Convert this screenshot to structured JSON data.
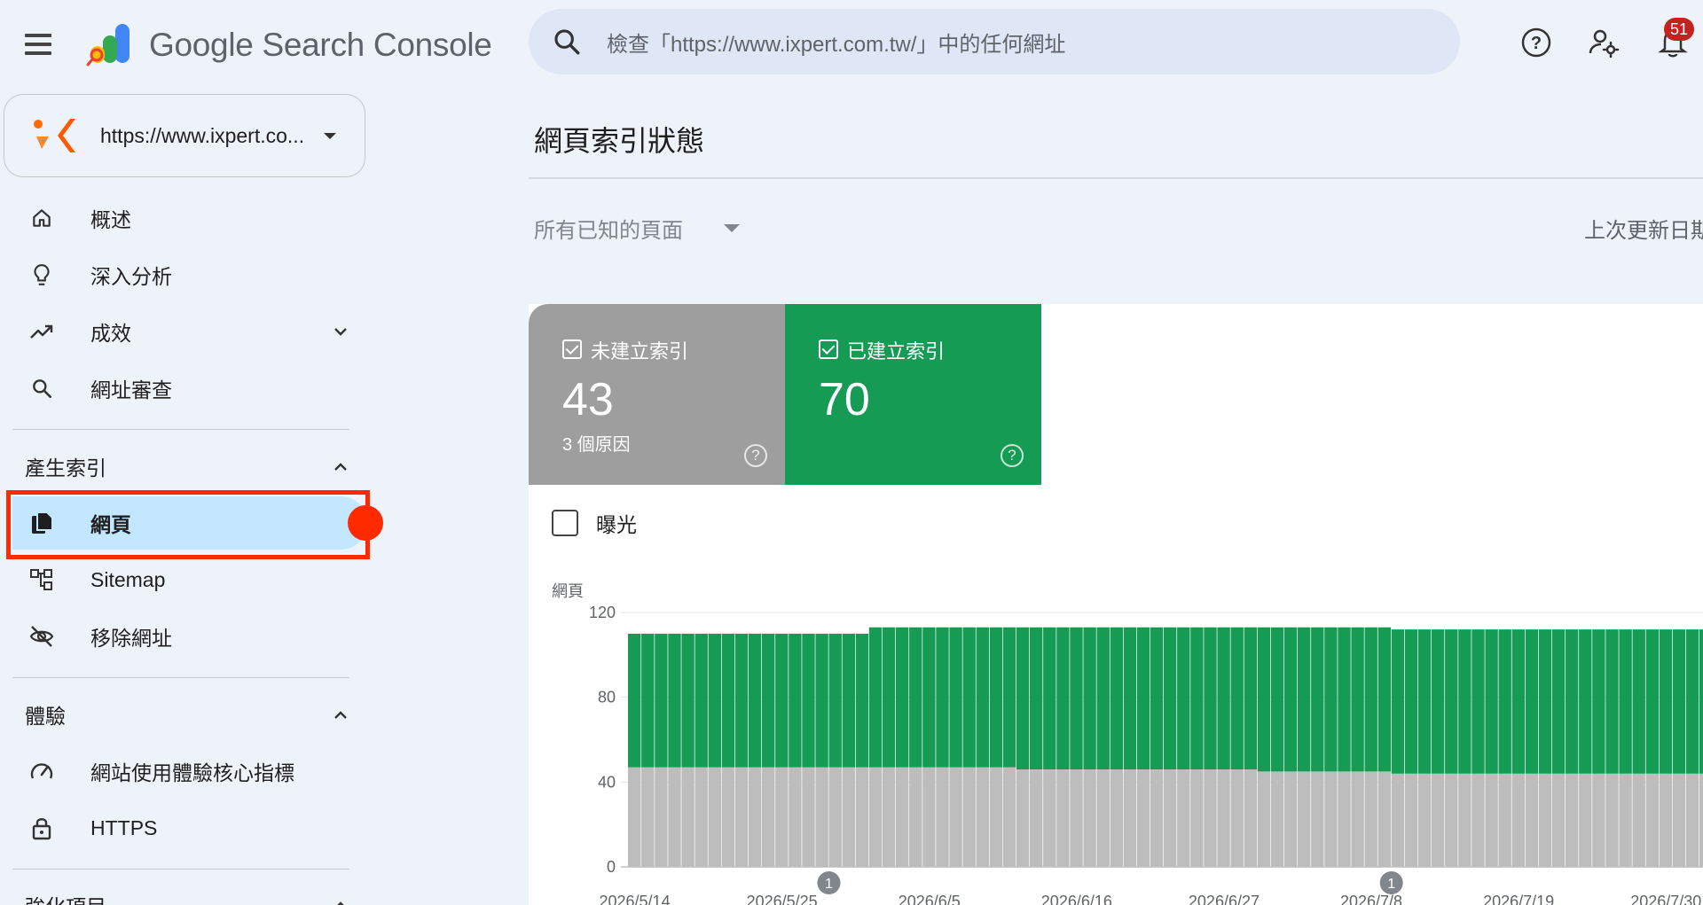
{
  "app": {
    "title": "Google Search Console"
  },
  "search": {
    "placeholder": "檢查「https://www.ixpert.com.tw/」中的任何網址"
  },
  "notifications": {
    "count": "51"
  },
  "property": {
    "url": "https://www.ixpert.co..."
  },
  "sidebar": {
    "items": [
      {
        "label": "概述",
        "icon": "home-icon"
      },
      {
        "label": "深入分析",
        "icon": "lightbulb-icon"
      },
      {
        "label": "成效",
        "icon": "trending-up-icon"
      },
      {
        "label": "網址審查",
        "icon": "search-icon"
      }
    ],
    "sections": [
      {
        "label": "產生索引",
        "items": [
          {
            "label": "網頁",
            "icon": "pages-icon",
            "active": true
          },
          {
            "label": "Sitemap",
            "icon": "sitemap-icon"
          },
          {
            "label": "移除網址",
            "icon": "visibility-off-icon"
          }
        ]
      },
      {
        "label": "體驗",
        "items": [
          {
            "label": "網站使用體驗核心指標",
            "icon": "speed-icon"
          },
          {
            "label": "HTTPS",
            "icon": "lock-icon"
          }
        ]
      },
      {
        "label": "強化項目"
      }
    ]
  },
  "main": {
    "title": "網頁索引狀態",
    "filter": "所有已知的頁面",
    "last_update": "上次更新日期"
  },
  "tiles": {
    "unindexed": {
      "label": "未建立索引",
      "value": "43",
      "sub": "3 個原因",
      "color": "#9e9e9e"
    },
    "indexed": {
      "label": "已建立索引",
      "value": "70",
      "color": "#159b54"
    }
  },
  "impressions": {
    "label": "曝光"
  },
  "colors": {
    "accent": "#c2e7ff",
    "indexed": "#159b54",
    "unindexed": "#bdbdbd",
    "annotation": "#ff2a00"
  },
  "chart_data": {
    "type": "bar",
    "stacked": true,
    "ylabel": "網頁",
    "ylim": [
      0,
      120
    ],
    "yticks": [
      0,
      40,
      80,
      120
    ],
    "x_tick_labels": [
      "2026/5/14",
      "2026/5/25",
      "2026/6/5",
      "2026/6/16",
      "2026/6/27",
      "2026/7/8",
      "2026/7/19",
      "2026/7/30"
    ],
    "annotations": [
      "1",
      "1"
    ],
    "segments": [
      {
        "days": 18,
        "unindexed": 47,
        "indexed": 63
      },
      {
        "days": 11,
        "unindexed": 47,
        "indexed": 66
      },
      {
        "days": 18,
        "unindexed": 46,
        "indexed": 67
      },
      {
        "days": 10,
        "unindexed": 45,
        "indexed": 68
      },
      {
        "days": 27,
        "unindexed": 44,
        "indexed": 68
      }
    ]
  }
}
